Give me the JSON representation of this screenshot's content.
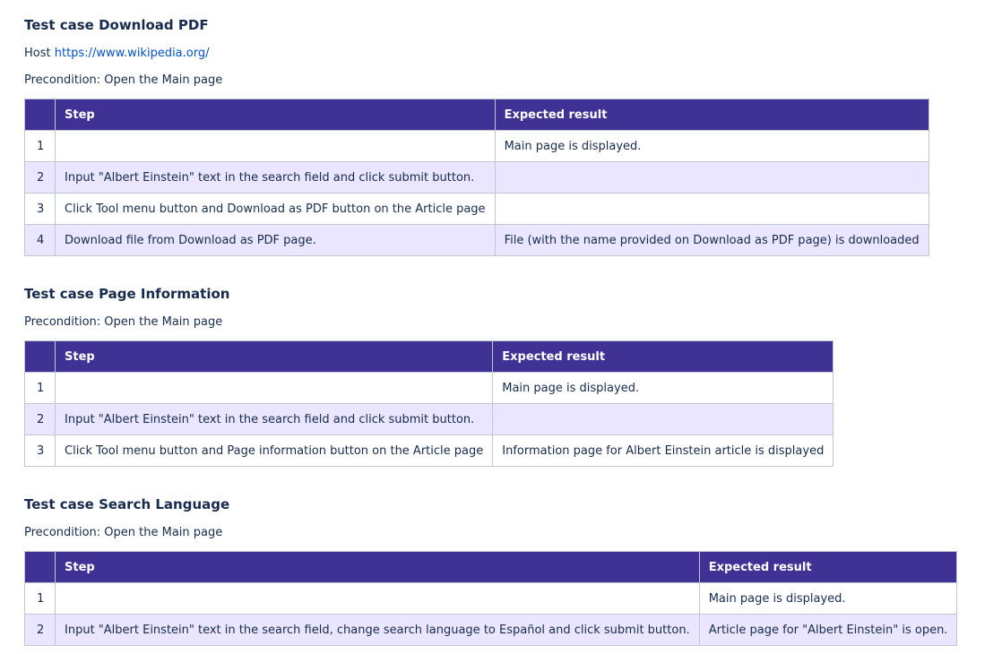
{
  "sections": [
    {
      "title": "Test case Download PDF",
      "host_label": "Host",
      "host_url": "https://www.wikipedia.org/",
      "precondition": "Precondition: Open the Main page",
      "headers": {
        "num": "",
        "step": "Step",
        "expected": "Expected result"
      },
      "rows": [
        {
          "num": "1",
          "step": "",
          "expected": "Main page is displayed."
        },
        {
          "num": "2",
          "step": "Input \"Albert Einstein\" text in the search field and click submit button.",
          "expected": ""
        },
        {
          "num": "3",
          "step": "Click Tool menu button and Download as PDF button on the Article page",
          "expected": ""
        },
        {
          "num": "4",
          "step": "Download file from Download as PDF page.",
          "expected": "File (with the name provided on Download as PDF page) is downloaded"
        }
      ]
    },
    {
      "title": "Test case Page Information",
      "precondition": "Precondition: Open the Main page",
      "headers": {
        "num": "",
        "step": "Step",
        "expected": "Expected result"
      },
      "rows": [
        {
          "num": "1",
          "step": "",
          "expected": "Main page is displayed."
        },
        {
          "num": "2",
          "step": "Input \"Albert Einstein\" text in the search field and click submit button.",
          "expected": ""
        },
        {
          "num": "3",
          "step": "Click Tool menu button and Page information button on the Article page",
          "expected": "Information page for Albert Einstein article is displayed"
        }
      ]
    },
    {
      "title": "Test case Search Language",
      "precondition": "Precondition: Open the Main page",
      "headers": {
        "num": "",
        "step": "Step",
        "expected": "Expected result"
      },
      "rows": [
        {
          "num": "1",
          "step": "",
          "expected": "Main page is displayed."
        },
        {
          "num": "2",
          "step": "Input \"Albert Einstein\" text in the search field, change search language to Español and click submit button.",
          "expected": "Article page for \"Albert Einstein\" is open."
        }
      ]
    }
  ],
  "colors": {
    "header_bg": "#403294",
    "alt_row_bg": "#eae6ff",
    "link": "#0052cc",
    "text": "#172b4d"
  }
}
